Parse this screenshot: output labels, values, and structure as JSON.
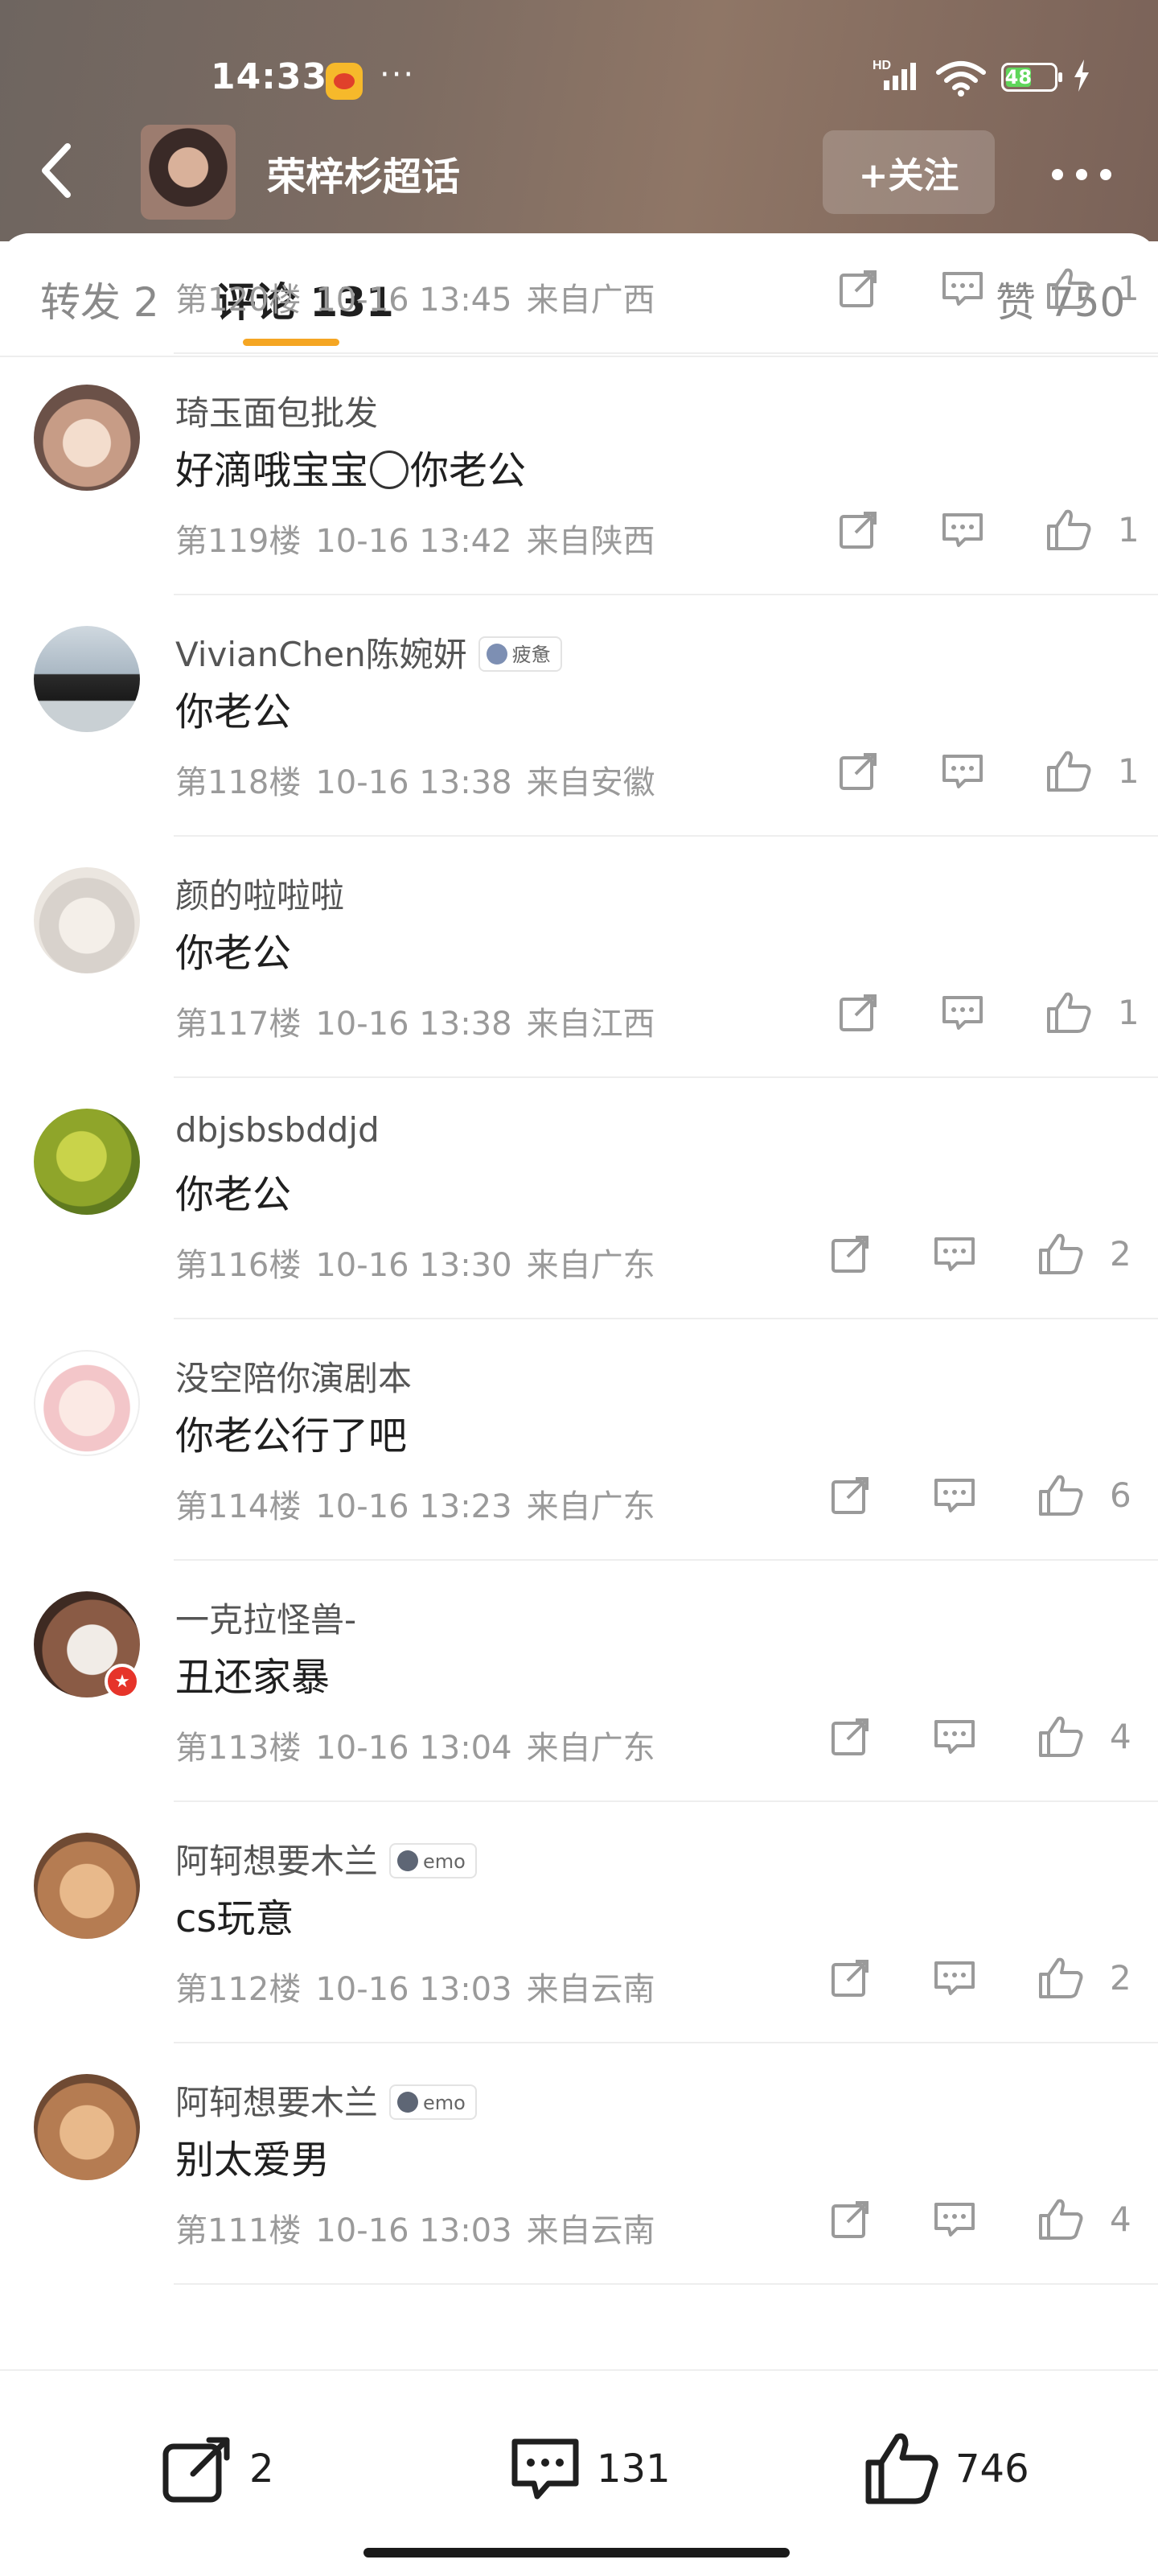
{
  "status_bar": {
    "time": "14:33",
    "battery_level": "48",
    "signal_label": "HD"
  },
  "nav": {
    "topic_title": "荣梓杉超话",
    "follow_label": "+关注"
  },
  "tabs": {
    "repost": "转发 2",
    "comments": "评论 131",
    "likes": "赞 750"
  },
  "comments": [
    {
      "floor": "第120楼",
      "date": "10-16 13:45",
      "region": "来自广西",
      "likes": "1"
    },
    {
      "user": "琦玉面包批发",
      "text_before": "好滴哦宝宝",
      "text_after": "你老公",
      "floor": "第119楼",
      "date": "10-16 13:42",
      "region": "来自陕西",
      "likes": "1"
    },
    {
      "user": "VivianChen陈婉妍",
      "tag": "疲惫",
      "text": "你老公",
      "floor": "第118楼",
      "date": "10-16 13:38",
      "region": "来自安徽",
      "likes": "1"
    },
    {
      "user": "颜的啦啦啦",
      "text": "你老公",
      "floor": "第117楼",
      "date": "10-16 13:38",
      "region": "来自江西",
      "likes": "1"
    },
    {
      "user": "dbjsbsbddjd",
      "text": "你老公",
      "floor": "第116楼",
      "date": "10-16 13:30",
      "region": "来自广东",
      "likes": "2"
    },
    {
      "user": "没空陪你演剧本",
      "text": "你老公行了吧",
      "floor": "第114楼",
      "date": "10-16 13:23",
      "region": "来自广东",
      "likes": "6"
    },
    {
      "user": "一克拉怪兽-",
      "text": "丑还家暴",
      "floor": "第113楼",
      "date": "10-16 13:04",
      "region": "来自广东",
      "likes": "4"
    },
    {
      "user": "阿轲想要木兰",
      "tag": "emo",
      "text": "cs玩意",
      "floor": "第112楼",
      "date": "10-16 13:03",
      "region": "来自云南",
      "likes": "2"
    },
    {
      "user": "阿轲想要木兰",
      "tag": "emo",
      "text": "别太爱男",
      "floor": "第111楼",
      "date": "10-16 13:03",
      "region": "来自云南",
      "likes": "4"
    }
  ],
  "bottom_bar": {
    "repost_count": "2",
    "comment_count": "131",
    "like_count": "746"
  },
  "colors": {
    "accent": "#f5a623",
    "meta_gray": "#9a9a9a",
    "header_brown": "#7d6c62"
  }
}
